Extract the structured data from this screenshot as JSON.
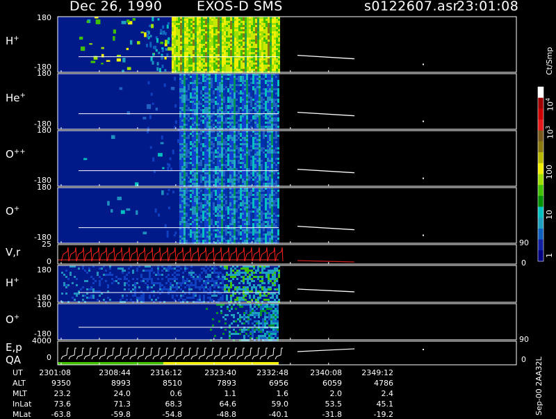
{
  "header": {
    "date_title": "Dec 26, 1990",
    "mission": "EXOS-D SMS",
    "file": "s0122607.asr",
    "time": "23:01:08"
  },
  "panels": [
    {
      "id": "h_plus_1",
      "label": "H",
      "sup": "+",
      "ytop": "180",
      "ybot": "-180"
    },
    {
      "id": "he_plus",
      "label": "He",
      "sup": "+",
      "ytop": "180",
      "ybot": "-180"
    },
    {
      "id": "o_plus_plus",
      "label": "O",
      "sup": "++",
      "ytop": "180",
      "ybot": "-180"
    },
    {
      "id": "o_plus_1",
      "label": "O",
      "sup": "+",
      "ytop": "180",
      "ybot": "-180"
    },
    {
      "id": "vr",
      "label": "V,r",
      "sup": "",
      "ytop": "25",
      "ybot": "0",
      "rtop": "90",
      "rbot": "0"
    },
    {
      "id": "h_plus_2",
      "label": "H",
      "sup": "+",
      "ytop": "180",
      "ybot": "-180"
    },
    {
      "id": "o_plus_2",
      "label": "O",
      "sup": "+",
      "ytop": "180",
      "ybot": "-180"
    },
    {
      "id": "ep",
      "label": "E,p",
      "sup": "",
      "label2": "QA",
      "ytop": "4000",
      "ybot": "0",
      "rtop": "90",
      "rbot": "0"
    }
  ],
  "colorbar": {
    "unit": "Ct/Smp",
    "ticks": [
      {
        "label": "10",
        "sup": "4"
      },
      {
        "label": "10",
        "sup": "3"
      },
      {
        "label": "100",
        "sup": ""
      },
      {
        "label": "10",
        "sup": ""
      },
      {
        "label": "1",
        "sup": ""
      }
    ],
    "colors": [
      "#ffffff",
      "#a00000",
      "#cc0000",
      "#e61a1a",
      "#7a5a1a",
      "#8a7a10",
      "#b8b800",
      "#f0f000",
      "#a0e000",
      "#40c000",
      "#009000",
      "#00c0c0",
      "#20a0c0",
      "#1060c0",
      "#1020a0",
      "#000080"
    ]
  },
  "ephemeris": {
    "rows": [
      {
        "label": "UT",
        "values": [
          "2301:08",
          "2308:44",
          "2316:12",
          "2323:40",
          "2332:48",
          "2340:08",
          "2349:12"
        ]
      },
      {
        "label": "ALT",
        "values": [
          "9350",
          "8993",
          "8510",
          "7893",
          "6956",
          "6059",
          "4786"
        ]
      },
      {
        "label": "MLT",
        "values": [
          "23.2",
          "24.0",
          "0.6",
          "1.1",
          "1.6",
          "2.0",
          "2.4"
        ]
      },
      {
        "label": "InLat",
        "values": [
          "73.6",
          "71.3",
          "68.3",
          "64.6",
          "59.0",
          "53.5",
          "45.1"
        ]
      },
      {
        "label": "MLat",
        "values": [
          "-63.8",
          "-59.8",
          "-54.8",
          "-48.8",
          "-40.1",
          "-31.8",
          "-19.2"
        ]
      }
    ]
  },
  "footer": {
    "stamp": "Sep-00 2AA32L"
  },
  "chart_data": {
    "type": "heatmap",
    "title": "Dec 26, 1990   EXOS-D SMS",
    "xlabel": "UT",
    "x_ticks": [
      "2301:08",
      "2308:44",
      "2316:12",
      "2323:40",
      "2332:48",
      "2340:08",
      "2349:12"
    ],
    "series": [
      {
        "name": "H+",
        "ylim": [
          -180,
          180
        ]
      },
      {
        "name": "He+",
        "ylim": [
          -180,
          180
        ]
      },
      {
        "name": "O++",
        "ylim": [
          -180,
          180
        ]
      },
      {
        "name": "O+",
        "ylim": [
          -180,
          180
        ]
      },
      {
        "name": "V,r",
        "ylim": [
          0,
          25
        ],
        "right_ylim": [
          0,
          90
        ]
      },
      {
        "name": "H+",
        "ylim": [
          -180,
          180
        ]
      },
      {
        "name": "O+",
        "ylim": [
          -180,
          180
        ]
      },
      {
        "name": "E,p",
        "ylim": [
          0,
          4000
        ],
        "right_ylim": [
          0,
          90
        ]
      }
    ],
    "colorbar_label": "Ct/Smp",
    "colorbar_ticks": [
      "1",
      "10",
      "100",
      "10^3",
      "10^4"
    ]
  }
}
